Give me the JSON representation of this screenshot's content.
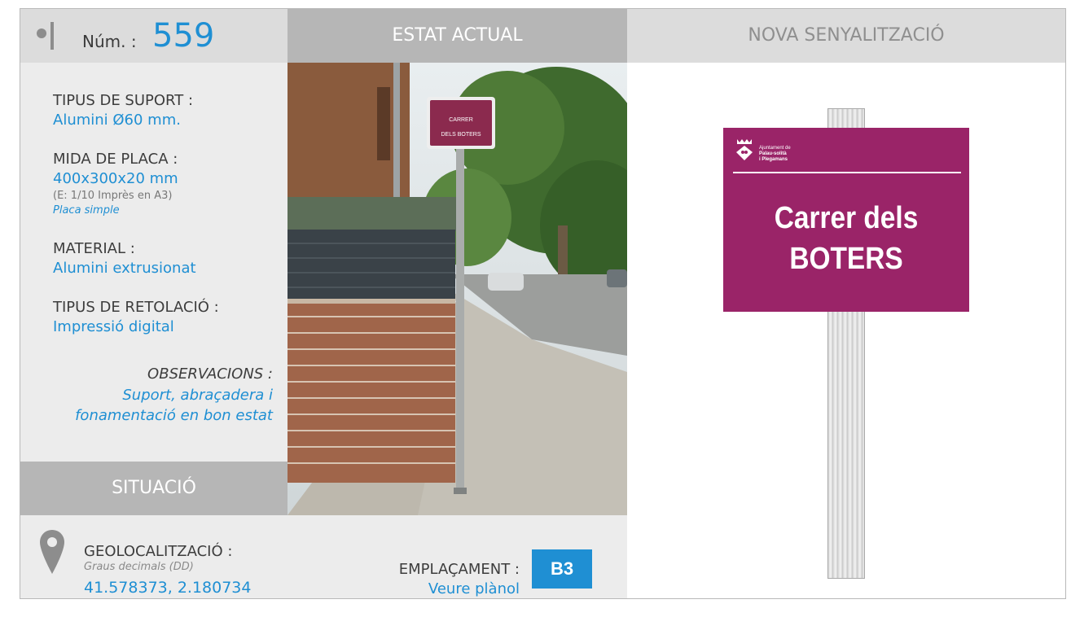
{
  "header": {
    "num_label": "Núm. :",
    "num_value": "559",
    "estat_actual": "ESTAT ACTUAL",
    "nova_senyalitzacio": "NOVA SENYALITZACIÓ"
  },
  "fields": {
    "tipus_suport_label": "TIPUS DE SUPORT :",
    "tipus_suport_value": "Alumini Ø60 mm.",
    "mida_label": "MIDA DE PLACA :",
    "mida_value": "400x300x20 mm",
    "mida_note": "(E: 1/10 Imprès en A3)",
    "mida_italic": "Placa simple",
    "material_label": "MATERIAL :",
    "material_value": "Alumini extrusionat",
    "retolacio_label": "TIPUS DE RETOLACIÓ :",
    "retolacio_value": "Impressió digital",
    "observacions_label": "OBSERVACIONS :",
    "observacions_line1": "Suport, abraçadera i",
    "observacions_line2": "fonamentació en bon estat"
  },
  "situacio": "SITUACIÓ",
  "geo": {
    "label": "GEOLOCALITZACIÓ :",
    "sub": "Graus decimals (DD)",
    "value": "41.578373, 2.180734"
  },
  "emplacament": {
    "label": "EMPLAÇAMENT :",
    "value": "Veure plànol",
    "badge": "B3"
  },
  "photo_sign": {
    "line1": "CARRER",
    "line2": "DELS BOTERS"
  },
  "plate": {
    "logo_line1": "Ajuntament de",
    "logo_line2": "Palau-solità",
    "logo_line3": "i Plegamans",
    "line1": "Carrer dels",
    "line2": "BOTERS"
  },
  "colors": {
    "accent": "#1f8fd3",
    "plate": "#9a2468",
    "header_dark": "#b6b6b6",
    "header_light": "#dcdcdc",
    "panel": "#ececec"
  }
}
